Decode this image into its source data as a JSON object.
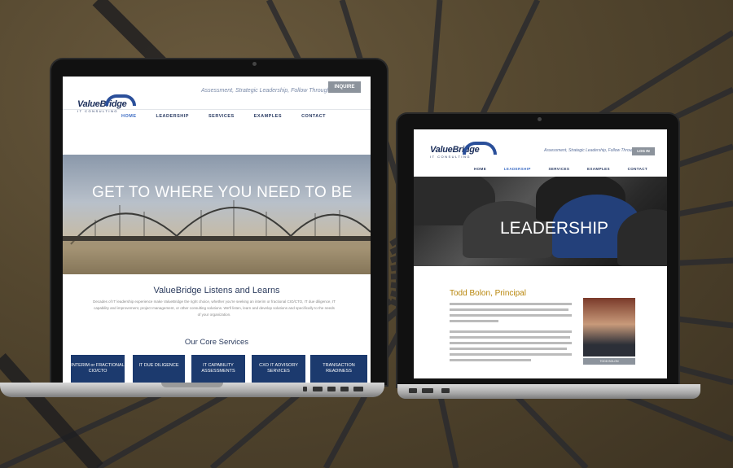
{
  "laptop_left": {
    "tagline": "Assessment, Strategic Leadership, Follow Through",
    "inquire_label": "INQUIRE",
    "logo": "ValueBridge",
    "logo_sub": "IT CONSULTING",
    "nav": [
      "HOME",
      "LEADERSHIP",
      "SERVICES",
      "EXAMPLES",
      "CONTACT"
    ],
    "hero_title": "GET TO WHERE YOU NEED TO BE",
    "heading": "ValueBridge Listens and Learns",
    "paragraph": "Decades of IT leadership experience make ValueBridge the right choice, whether you're seeking an interim or fractional CIO/CTO, IT due diligence, IT capability and improvement, project management, or other consulting solutions. We'll listen, learn and develop solutions and specifically to the needs of your organization.",
    "core_heading": "Our Core Services",
    "services": [
      "INTERIM or FRACTIONAL CIO/CTO",
      "IT DUE DILIGENCE",
      "IT CAPABILITY ASSESSMENTS",
      "CXO IT ADVISORY SERVICES",
      "TRANSACTION READINESS"
    ]
  },
  "laptop_right": {
    "tagline": "Assessment, Strategic Leadership, Follow Through",
    "login_label": "LOG IN",
    "logo": "ValueBridge",
    "logo_sub": "IT CONSULTING",
    "nav": [
      "HOME",
      "LEADERSHIP",
      "SERVICES",
      "EXAMPLES",
      "CONTACT"
    ],
    "hero_title": "LEADERSHIP",
    "person_name": "Todd Bolon, Principal",
    "photo_caption": "TODD BOLON"
  },
  "colors": {
    "navy": "#1c3a6e",
    "accent_gold": "#b8860b",
    "gray_button": "#8c939c"
  }
}
